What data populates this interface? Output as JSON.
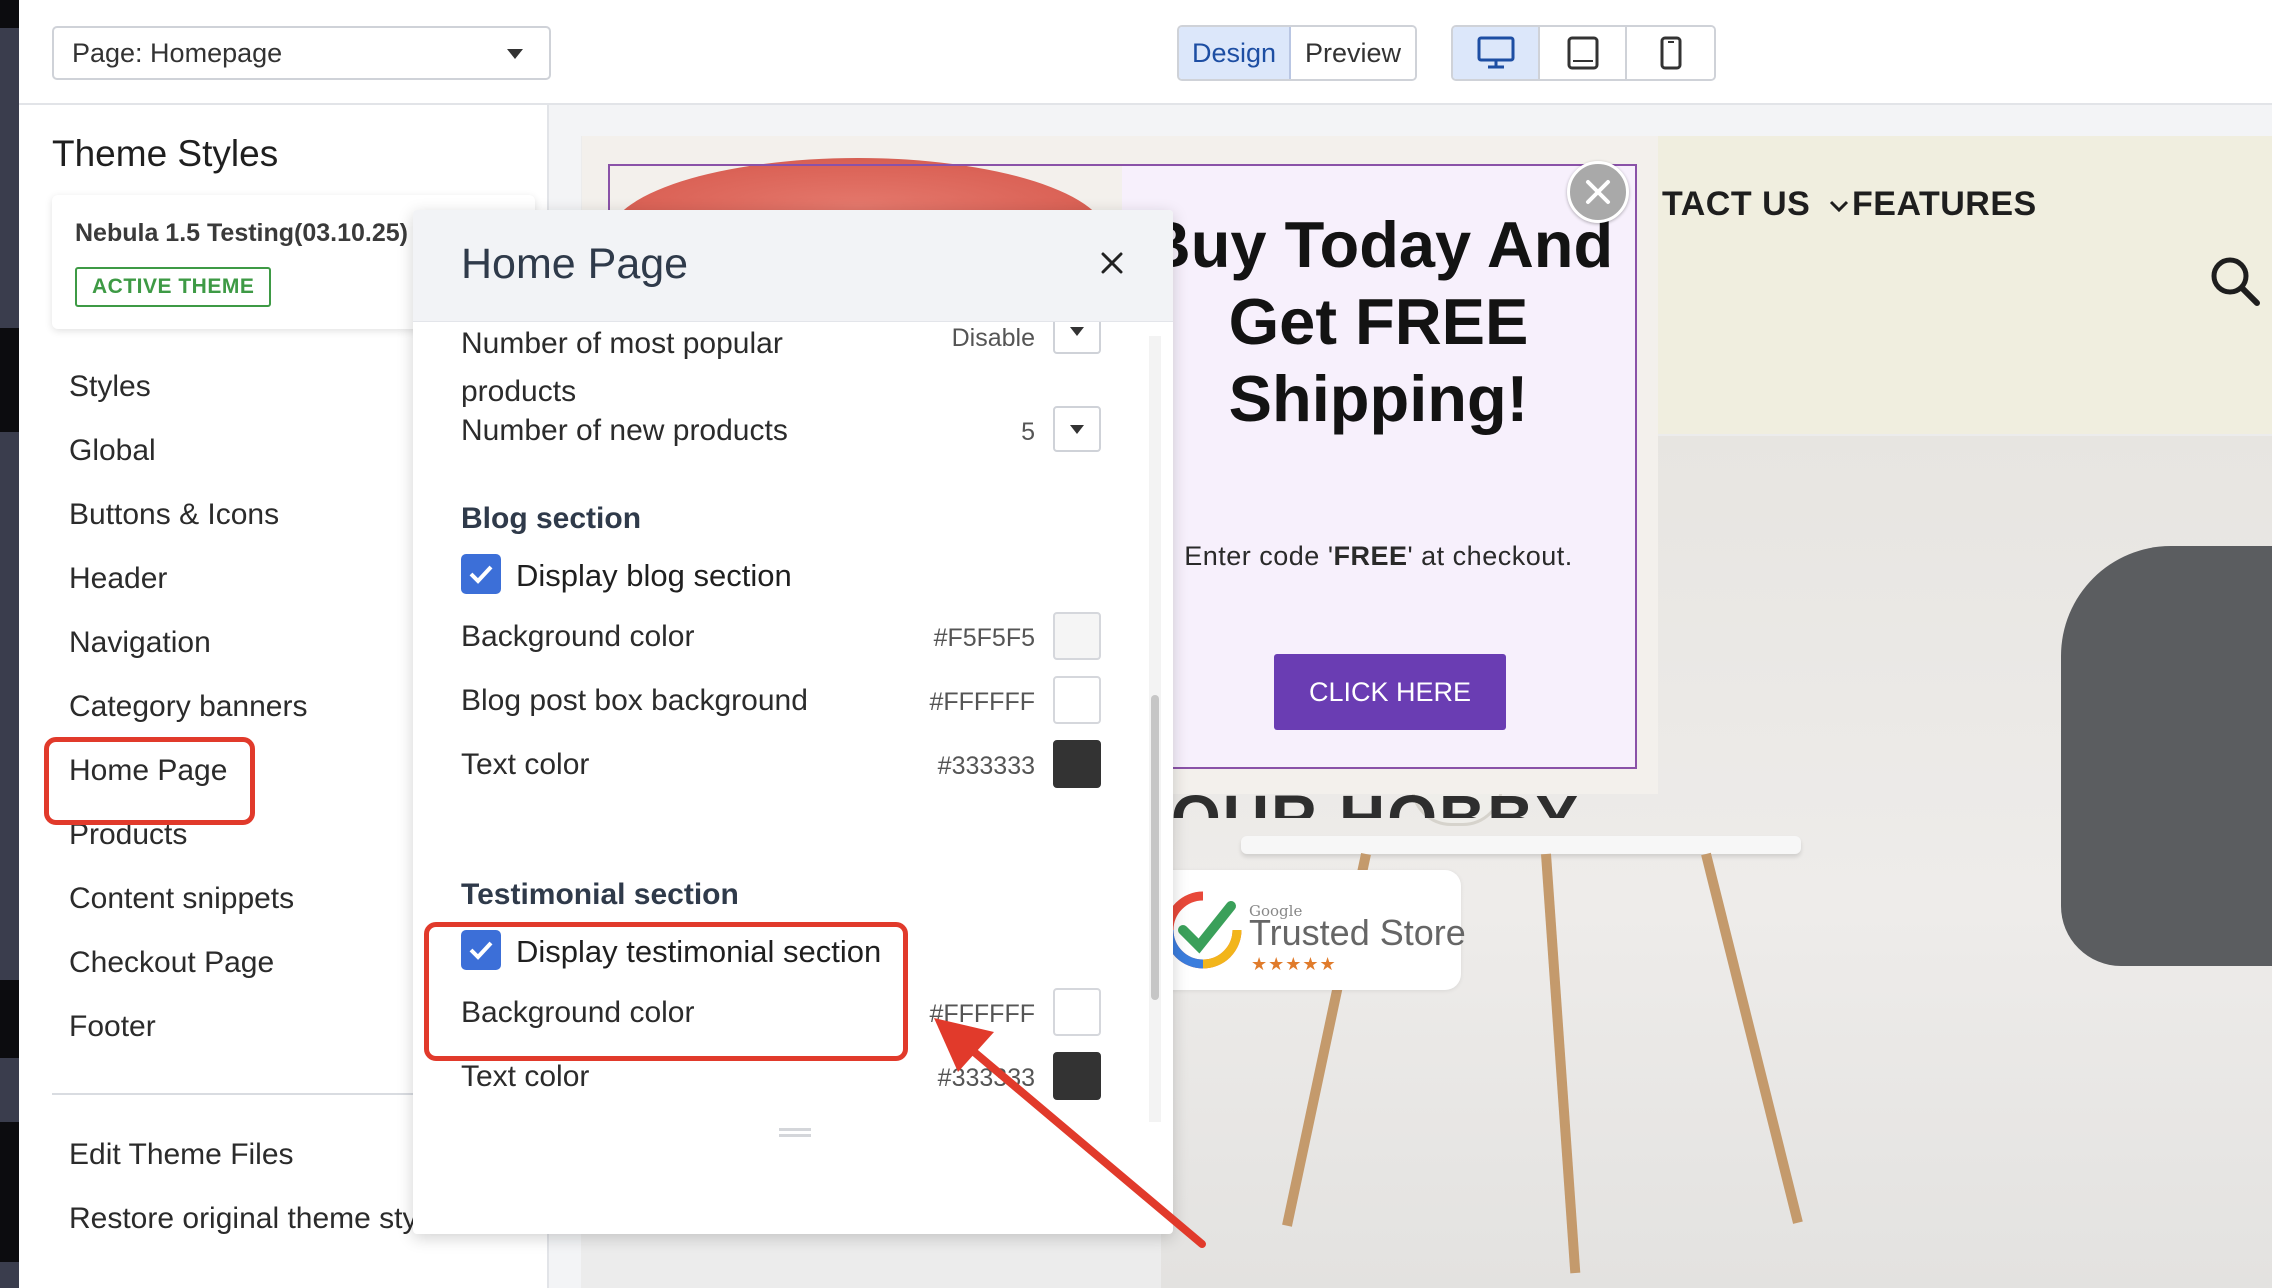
{
  "topbar": {
    "page_select": "Page: Homepage",
    "mode_design": "Design",
    "mode_preview": "Preview",
    "devices": [
      "desktop-icon",
      "tablet-icon",
      "mobile-icon"
    ],
    "active_device": "desktop-icon"
  },
  "sidebar": {
    "title": "Theme Styles",
    "theme_name": "Nebula 1.5 Testing(03.10.25)",
    "active_badge": "ACTIVE THEME",
    "items": [
      {
        "label": "Styles"
      },
      {
        "label": "Global"
      },
      {
        "label": "Buttons & Icons"
      },
      {
        "label": "Header"
      },
      {
        "label": "Navigation"
      },
      {
        "label": "Category banners"
      },
      {
        "label": "Home Page"
      },
      {
        "label": "Products"
      },
      {
        "label": "Content snippets"
      },
      {
        "label": "Checkout Page"
      },
      {
        "label": "Footer"
      }
    ],
    "bottom_items": [
      {
        "label": "Edit Theme Files"
      },
      {
        "label": "Restore original theme styles"
      }
    ]
  },
  "panel": {
    "title": "Home Page",
    "rows": {
      "popular_label": "Number of most popular products",
      "popular_value": "Disable",
      "new_label": "Number of new products",
      "new_value": "5"
    },
    "blog": {
      "title": "Blog section",
      "checkbox_label": "Display blog section",
      "bg_label": "Background color",
      "bg_value": "#F5F5F5",
      "box_label": "Blog post box background",
      "box_value": "#FFFFFF",
      "text_label": "Text color",
      "text_value": "#333333"
    },
    "testimonial": {
      "title": "Testimonial section",
      "checkbox_label": "Display testimonial section",
      "bg_label": "Background color",
      "bg_value": "#FFFFFF",
      "text_label": "Text color",
      "text_value": "#333333"
    }
  },
  "preview": {
    "nav_contact": "TACT US",
    "nav_features": "FEATURES",
    "hobby_text": "OUR HOBBY",
    "trusted_google": "Google",
    "trusted_label": "Trusted Store",
    "trusted_stars": "★★★★★",
    "popup": {
      "headline": "Buy Today And Get FREE Shipping!",
      "sub_before": "Enter code '",
      "sub_code": "FREE",
      "sub_after": "' at checkout.",
      "cta": "CLICK HERE"
    }
  },
  "colors": {
    "accent": "#3c6fd8",
    "highlight": "#e13a2b",
    "popup_button": "#6a3db3",
    "active_badge": "#3e9a45",
    "swatch_blog_bg": "#F5F5F5",
    "swatch_blog_box": "#FFFFFF",
    "swatch_blog_text": "#333333",
    "swatch_testimonial_bg": "#FFFFFF",
    "swatch_testimonial_text": "#333333"
  }
}
